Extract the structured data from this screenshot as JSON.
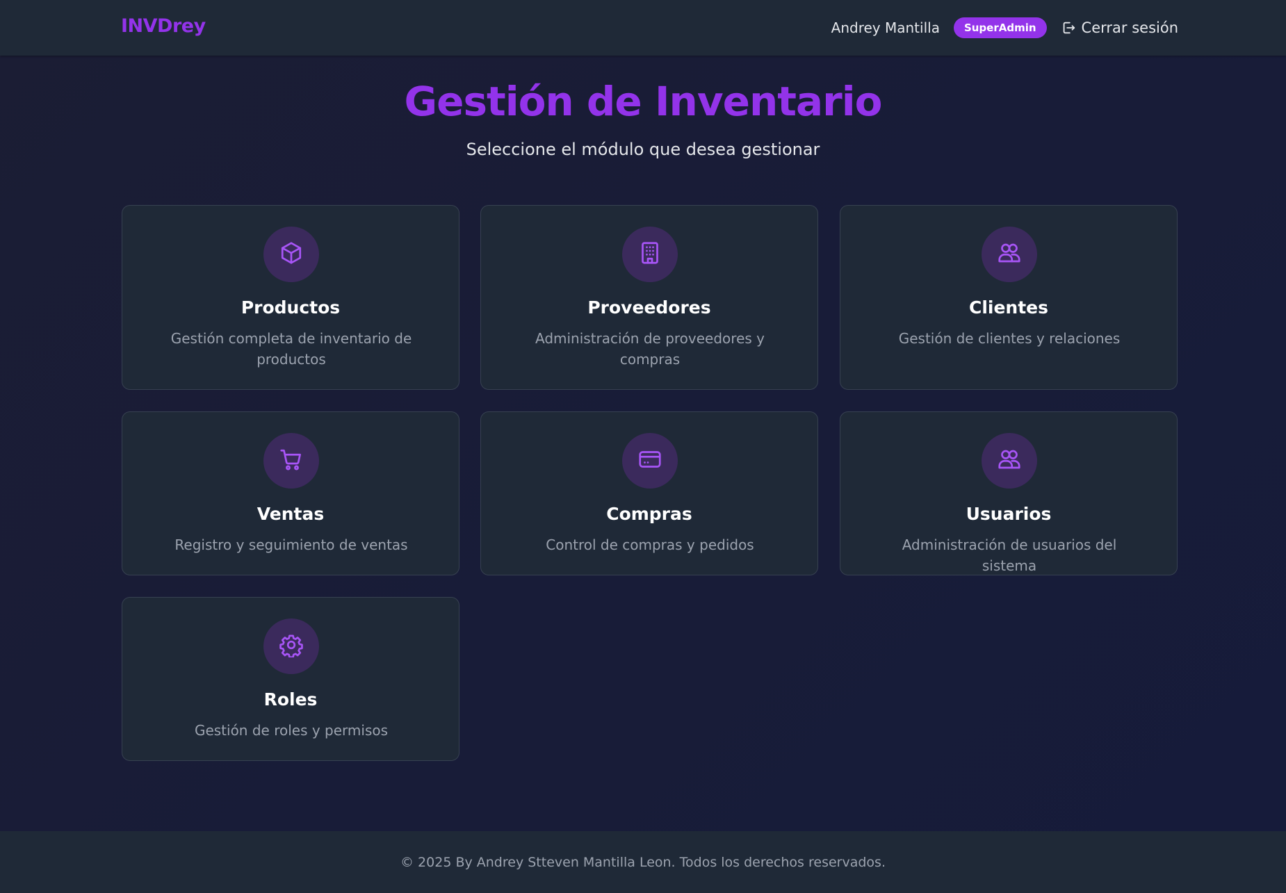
{
  "header": {
    "brand": "INVDrey",
    "user_name": "Andrey Mantilla",
    "role_badge": "SuperAdmin",
    "logout_label": "Cerrar sesión",
    "logout_icon": "logout-icon"
  },
  "main": {
    "title": "Gestión de Inventario",
    "subtitle": "Seleccione el módulo que desea gestionar",
    "modules": [
      {
        "title": "Productos",
        "description": "Gestión completa de inventario de productos",
        "icon": "box-icon"
      },
      {
        "title": "Proveedores",
        "description": "Administración de proveedores y compras",
        "icon": "building-icon"
      },
      {
        "title": "Clientes",
        "description": "Gestión de clientes y relaciones",
        "icon": "users-icon"
      },
      {
        "title": "Ventas",
        "description": "Registro y seguimiento de ventas",
        "icon": "cart-icon"
      },
      {
        "title": "Compras",
        "description": "Control de compras y pedidos",
        "icon": "credit-card-icon"
      },
      {
        "title": "Usuarios",
        "description": "Administración de usuarios del sistema",
        "icon": "users-icon"
      },
      {
        "title": "Roles",
        "description": "Gestión de roles y permisos",
        "icon": "gear-icon"
      }
    ]
  },
  "footer": {
    "text": "© 2025 By Andrey Stteven Mantilla Leon. Todos los derechos reservados."
  },
  "colors": {
    "accent": "#9333ea",
    "surface": "#1f2937",
    "background": "#1b1d34",
    "icon_circle": "#3b2a5c",
    "muted_text": "#9ca3af"
  }
}
